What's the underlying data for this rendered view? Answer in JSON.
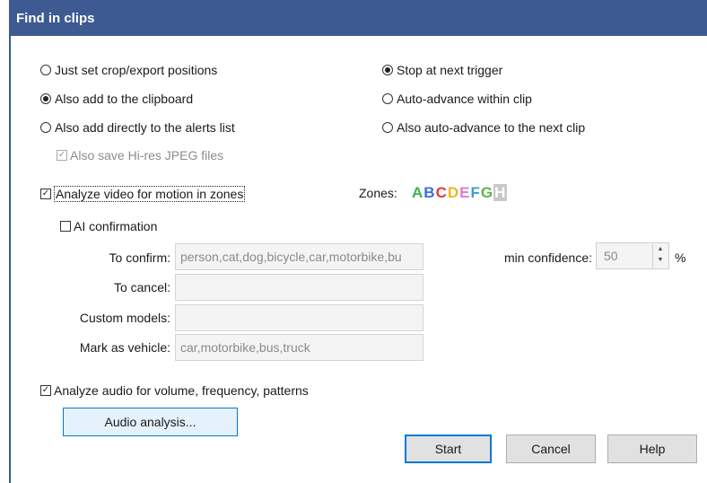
{
  "window": {
    "title": "Find in clips"
  },
  "options_left": [
    {
      "label": "Just set crop/export positions",
      "checked": false
    },
    {
      "label": "Also add to the clipboard",
      "checked": true
    },
    {
      "label": "Also add directly to the alerts list",
      "checked": false
    }
  ],
  "options_right": [
    {
      "label": "Stop at next trigger",
      "checked": true
    },
    {
      "label": "Auto-advance within clip",
      "checked": false
    },
    {
      "label": "Also auto-advance to the next clip",
      "checked": false
    }
  ],
  "hires": {
    "label": "Also save Hi-res JPEG files",
    "checked": true,
    "enabled": false
  },
  "motion": {
    "label": "Analyze video for motion in zones",
    "checked": true
  },
  "zones": {
    "label": "Zones:",
    "letters": [
      {
        "letter": "A",
        "color": "#3bb54a"
      },
      {
        "letter": "B",
        "color": "#3f6fd9"
      },
      {
        "letter": "C",
        "color": "#e03b3b"
      },
      {
        "letter": "D",
        "color": "#f2b51d"
      },
      {
        "letter": "E",
        "color": "#e07ad0"
      },
      {
        "letter": "F",
        "color": "#3b9fd9"
      },
      {
        "letter": "G",
        "color": "#5bb546"
      },
      {
        "letter": "H",
        "color": "#c0c0c0"
      }
    ]
  },
  "ai": {
    "label": "AI confirmation",
    "checked": false,
    "to_confirm_label": "To confirm:",
    "to_confirm_value": "person,cat,dog,bicycle,car,motorbike,bu",
    "to_cancel_label": "To cancel:",
    "to_cancel_value": "",
    "custom_models_label": "Custom models:",
    "custom_models_value": "",
    "mark_vehicle_label": "Mark as vehicle:",
    "mark_vehicle_value": "car,motorbike,bus,truck",
    "min_conf_label": "min confidence:",
    "min_conf_value": "50",
    "percent": "%"
  },
  "audio": {
    "label": "Analyze audio for volume, frequency, patterns",
    "checked": true,
    "button": "Audio analysis..."
  },
  "buttons": {
    "start": "Start",
    "cancel": "Cancel",
    "help": "Help"
  }
}
